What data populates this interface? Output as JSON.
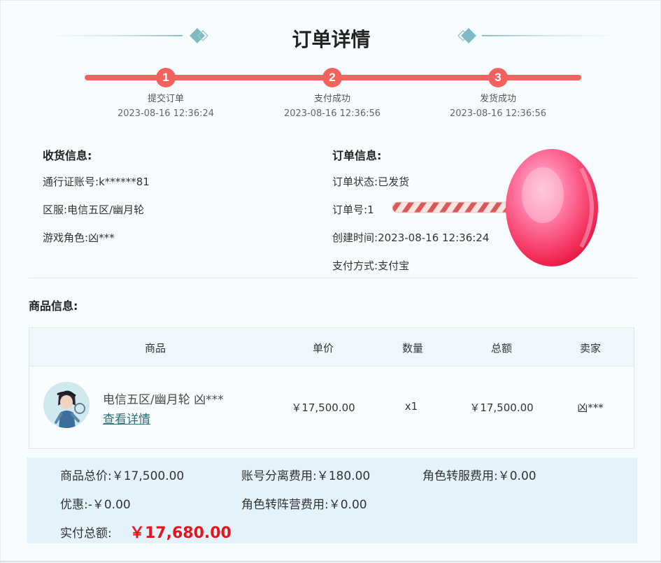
{
  "header": {
    "title": "订单详情"
  },
  "progress": {
    "steps": [
      {
        "number": "1",
        "label": "提交订单",
        "time": "2023-08-16 12:36:24"
      },
      {
        "number": "2",
        "label": "支付成功",
        "time": "2023-08-16 12:36:56"
      },
      {
        "number": "3",
        "label": "发货成功",
        "time": "2023-08-16 12:36:56"
      }
    ]
  },
  "shipping": {
    "title": "收货信息:",
    "rows": [
      {
        "label": "通行证账号:",
        "value": "k******81"
      },
      {
        "label": "区服:",
        "value": "电信五区/幽月轮"
      },
      {
        "label": "游戏角色:",
        "value": "凶***"
      }
    ]
  },
  "order": {
    "title": "订单信息:",
    "rows": [
      {
        "label": "订单状态:",
        "value": "已发货"
      },
      {
        "label": "订单号:",
        "value": "1"
      },
      {
        "label": "创建时间:",
        "value": "2023-08-16 12:36:24"
      },
      {
        "label": "支付方式:",
        "value": "支付宝"
      }
    ]
  },
  "products": {
    "title": "商品信息:",
    "columns": [
      "商品",
      "单价",
      "数量",
      "总额",
      "卖家"
    ],
    "rows": [
      {
        "name": "电信五区/幽月轮 凶***",
        "link": "查看详情",
        "unit_price": "￥17,500.00",
        "quantity": "x1",
        "total": "￥17,500.00",
        "seller": "凶***"
      }
    ]
  },
  "summary": {
    "goods_total": "商品总价:￥17,500.00",
    "separation_fee": "账号分离费用:￥180.00",
    "transfer_fee": "角色转服费用:￥0.00",
    "discount": "优惠:-￥0.00",
    "faction_fee": "角色转阵营费用:￥0.00",
    "paid_label": "实付总额:",
    "paid_value": "￥17,680.00"
  },
  "colors": {
    "accent": "#f3625e",
    "total": "#e9131b",
    "link": "#2b6f7a",
    "summary_bg": "#e4f3fb"
  },
  "icons": [
    "diamond-ornament-icon",
    "lollipop-sticker-icon",
    "avatar-image"
  ]
}
